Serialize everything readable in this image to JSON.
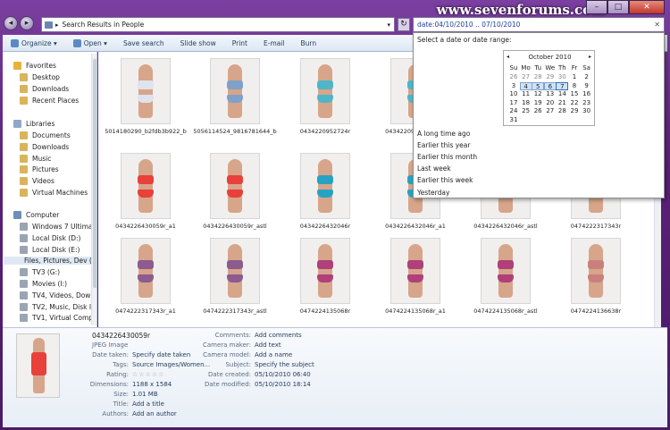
{
  "watermark": "www.sevenforums.com",
  "window_controls": {
    "minimize": "–",
    "maximize": "□",
    "close": "✕"
  },
  "address": {
    "path": "Search Results in People",
    "separator": "▸"
  },
  "search": {
    "label": "date:",
    "value": "04/10/2010 .. 07/10/2010"
  },
  "toolbar": [
    {
      "label": "Organize ▾",
      "icon": "organize-icon"
    },
    {
      "label": "Open ▾",
      "icon": "open-icon"
    },
    {
      "label": "Save search"
    },
    {
      "label": "Slide show"
    },
    {
      "label": "Print"
    },
    {
      "label": "E-mail"
    },
    {
      "label": "Burn"
    }
  ],
  "nav": {
    "favorites": {
      "label": "Favorites",
      "items": [
        "Desktop",
        "Downloads",
        "Recent Places"
      ]
    },
    "libraries": {
      "label": "Libraries",
      "items": [
        "Documents",
        "Downloads",
        "Music",
        "Pictures",
        "Videos",
        "Virtual Machines"
      ]
    },
    "computer": {
      "label": "Computer",
      "items": [
        "Windows 7 Ultimate",
        "Local Disk (D:)",
        "Local Disk (E:)",
        "Files, Pictures, Dev (F:)",
        "TV3 (G:)",
        "Movies (I:)",
        "TV4, Videos, Downloads",
        "TV2, Music, Disk Images",
        "TV1, Virtual Computers"
      ]
    }
  },
  "files": [
    {
      "name": "5014180290_b2fdb3b922_b",
      "suit": "#dfe3ec"
    },
    {
      "name": "5056114524_9816781644_b",
      "suit": "#7fa0c8"
    },
    {
      "name": "0434220952724r",
      "suit": "#4fb6c8"
    },
    {
      "name": "0434220952724r_a1",
      "suit": "#4fb6c8"
    },
    {
      "name": "",
      "suit": ""
    },
    {
      "name": "",
      "suit": ""
    },
    {
      "name": "0434226430059r_a1",
      "suit": "#e8403a"
    },
    {
      "name": "0434226430059r_astl",
      "suit": "#e8403a"
    },
    {
      "name": "0434226432046r",
      "suit": "#27a3c2"
    },
    {
      "name": "0434226432046r_a1",
      "suit": "#27a3c2"
    },
    {
      "name": "0434226432046r_astl",
      "suit": "#27a3c2"
    },
    {
      "name": "0474222317343r",
      "suit": "#8c5b8f"
    },
    {
      "name": "0474222317343r_a1",
      "suit": "#8c5b8f"
    },
    {
      "name": "0474222317343r_astl",
      "suit": "#8c5b8f"
    },
    {
      "name": "0474224135068r",
      "suit": "#b0407a"
    },
    {
      "name": "0474224135068r_a1",
      "suit": "#b0407a"
    },
    {
      "name": "0474224135068r_astl",
      "suit": "#b0407a"
    },
    {
      "name": "0474224136638r",
      "suit": "#c9807c"
    }
  ],
  "picker": {
    "header": "Select a date or date range:",
    "month": "October 2010",
    "prev": "◂",
    "next": "▸",
    "dow": [
      "Su",
      "Mo",
      "Tu",
      "We",
      "Th",
      "Fr",
      "Sa"
    ],
    "weeks": [
      [
        "26",
        "27",
        "28",
        "29",
        "30",
        "1",
        "2"
      ],
      [
        "3",
        "4",
        "5",
        "6",
        "7",
        "8",
        "9"
      ],
      [
        "10",
        "11",
        "12",
        "13",
        "14",
        "15",
        "16"
      ],
      [
        "17",
        "18",
        "19",
        "20",
        "21",
        "22",
        "23"
      ],
      [
        "24",
        "25",
        "26",
        "27",
        "28",
        "29",
        "30"
      ],
      [
        "31",
        "",
        "",
        "",
        "",
        "",
        ""
      ]
    ],
    "selected_range": [
      "4",
      "5",
      "6",
      "7"
    ],
    "options": [
      "A long time ago",
      "Earlier this year",
      "Earlier this month",
      "Last week",
      "Earlier this week",
      "Yesterday"
    ]
  },
  "details": {
    "name": "0434226430059r",
    "type": "JPEG Image",
    "left": [
      {
        "label": "Date taken:",
        "value": "Specify date taken"
      },
      {
        "label": "Tags:",
        "value": "Source Images/Women..."
      },
      {
        "label": "Rating:",
        "value": "☆☆☆☆☆"
      },
      {
        "label": "Dimensions:",
        "value": "1188 x 1584"
      },
      {
        "label": "Size:",
        "value": "1.01 MB"
      },
      {
        "label": "Title:",
        "value": "Add a title"
      },
      {
        "label": "Authors:",
        "value": "Add an author"
      }
    ],
    "right": [
      {
        "label": "Comments:",
        "value": "Add comments"
      },
      {
        "label": "Camera maker:",
        "value": "Add text"
      },
      {
        "label": "Camera model:",
        "value": "Add a name"
      },
      {
        "label": "Subject:",
        "value": "Specify the subject"
      },
      {
        "label": "Date created:",
        "value": "05/10/2010 06:40"
      },
      {
        "label": "Date modified:",
        "value": "05/10/2010 18:14"
      }
    ]
  },
  "colors": {
    "frame": "#5b2077",
    "toolbar_text": "#1e395b",
    "selection": "#cfe3f7",
    "link_blue": "#1f3f9b"
  }
}
